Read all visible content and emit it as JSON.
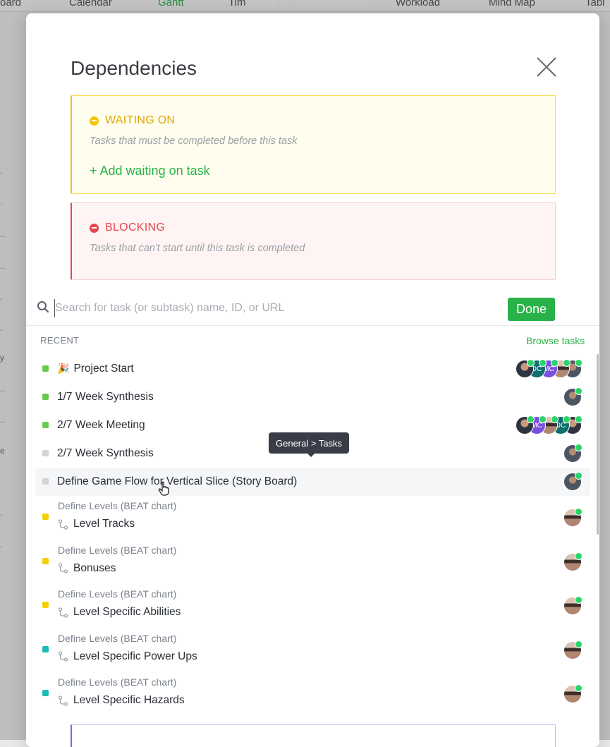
{
  "background": {
    "tabs": [
      "oard",
      "Calendar",
      "Gantt",
      "Tim",
      "Workload",
      "Mind Map",
      "Tabl"
    ],
    "search_text": "Search to add dependency",
    "side_dots": [
      ". ",
      ". ",
      "..",
      "..",
      ". ",
      ". ",
      "y",
      "..",
      "..",
      "e",
      ". ",
      ". "
    ]
  },
  "modal": {
    "title": "Dependencies",
    "waiting": {
      "label": "WAITING ON",
      "description": "Tasks that must be completed before this task",
      "add_link": "+ Add waiting on task"
    },
    "blocking": {
      "label": "BLOCKING",
      "description": "Tasks that can't start until this task is completed"
    },
    "search": {
      "placeholder": "Search for task (or subtask) name, ID, or URL",
      "value": ""
    },
    "done_label": "Done",
    "recent_label": "RECENT",
    "browse_label": "Browse tasks",
    "tooltip": "General > Tasks",
    "tasks": [
      {
        "name": "Project Start",
        "status_color": "#6bc950",
        "emoji": "🎉",
        "assignees": [
          "photo",
          "DC",
          "MC",
          "photo2",
          "photo3"
        ]
      },
      {
        "name": "1/7 Week Synthesis",
        "status_color": "#6bc950",
        "assignees": [
          "photo3"
        ]
      },
      {
        "name": "2/7 Week Meeting",
        "status_color": "#6bc950",
        "assignees": [
          "photo",
          "MC",
          "photo2",
          "DC",
          "photo"
        ]
      },
      {
        "name": "2/7 Week Synthesis",
        "status_color": "#d3d3d3",
        "assignees": [
          "photo3"
        ]
      },
      {
        "name": "Define Game Flow for Vertical Slice (Story Board)",
        "status_color": "#d3d3d3",
        "assignees": [
          "photo3"
        ]
      },
      {
        "parent": "Define Levels (BEAT chart)",
        "name": "Level Tracks",
        "status_color": "#f5d000",
        "assignees": [
          "photo2"
        ]
      },
      {
        "parent": "Define Levels (BEAT chart)",
        "name": "Bonuses",
        "status_color": "#f5d000",
        "assignees": [
          "photo2"
        ]
      },
      {
        "parent": "Define Levels (BEAT chart)",
        "name": "Level Specific Abilities",
        "status_color": "#f5d000",
        "assignees": [
          "photo2"
        ]
      },
      {
        "parent": "Define Levels (BEAT chart)",
        "name": "Level Specific Power Ups",
        "status_color": "#1bbcb3",
        "assignees": [
          "photo2"
        ]
      },
      {
        "parent": "Define Levels (BEAT chart)",
        "name": "Level Specific Hazards",
        "status_color": "#1bbcb3",
        "assignees": [
          "photo2"
        ]
      }
    ]
  },
  "colors": {
    "accent_green": "#2ab24a",
    "waiting_yellow": "#f5c400",
    "blocking_red": "#e5484d",
    "avatar_dc": "#0f6e6e",
    "avatar_mc": "#7b4fe0"
  }
}
